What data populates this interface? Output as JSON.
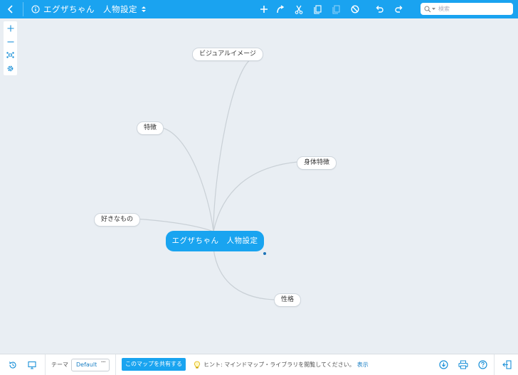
{
  "header": {
    "title": "エグザちゃん　人物設定",
    "search_placeholder": "検索"
  },
  "map": {
    "root": "エグザちゃん　人物設定",
    "branches": [
      "ビジュアルイメージ",
      "特徴",
      "身体特徴",
      "好きなもの",
      "性格"
    ]
  },
  "footer": {
    "theme_label": "テーマ",
    "theme_value": "Default",
    "share_label": "このマップを共有する",
    "hint_text": "ヒント: マインドマップ・ライブラリを閲覧してください。",
    "hint_link": "表示"
  },
  "colors": {
    "accent": "#1aa3f0",
    "canvas": "#e9eef3",
    "link": "#1a7fc4",
    "edge": "#c9d0d6"
  },
  "icons": {
    "back": "chevron-left-icon",
    "info": "info-icon",
    "add": "plus-icon",
    "connect": "curved-arrow-icon",
    "cut": "scissors-icon",
    "copy": "copy-icon",
    "paste": "paste-icon",
    "delete": "ban-icon",
    "undo": "undo-icon",
    "redo": "redo-icon",
    "search": "search-icon",
    "zoom_in": "plus-icon",
    "zoom_out": "minus-icon",
    "fit": "fit-icon",
    "settings": "gear-icon",
    "history": "history-icon",
    "present": "monitor-icon",
    "hint": "lightbulb-icon",
    "download": "download-icon",
    "print": "print-icon",
    "help": "help-icon",
    "exit": "exit-icon"
  }
}
